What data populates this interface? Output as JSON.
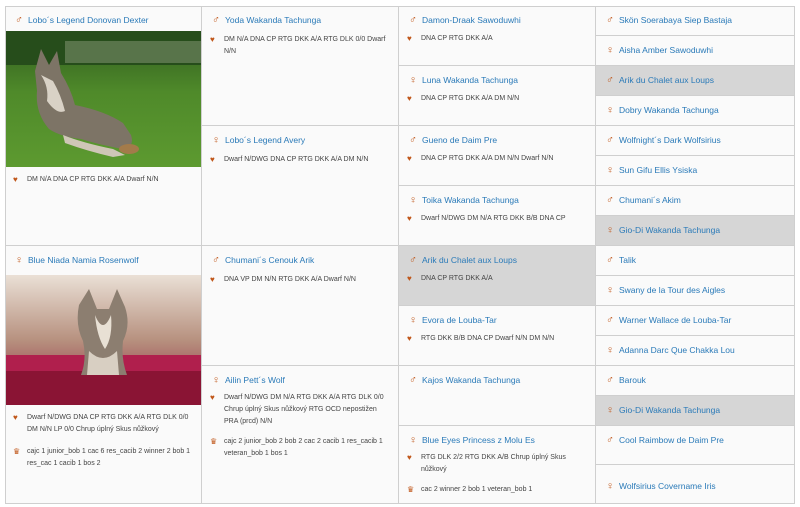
{
  "g1": [
    {
      "sex": "♂",
      "name": "Lobo´s Legend Donovan Dexter",
      "info": "DM N/A DNA CP RTG DKK A/A Dwarf N/N"
    },
    {
      "sex": "♀",
      "name": "Blue Niada Namia Rosenwolf",
      "info": "Dwarf N/DWG DNA CP RTG DKK A/A RTG DLK 0/0 DM N/N LP 0/0 Chrup úplný Skus nůžkový",
      "show": "cajc 1 junior_bob 1 cac 6 res_cacib 2 winner 2 bob 1 res_cac 1 cacib 1 bos 2"
    }
  ],
  "g2": [
    {
      "sex": "♂",
      "name": "Yoda Wakanda Tachunga",
      "info": "DM N/A DNA CP RTG DKK A/A RTG DLK 0/0 Dwarf N/N"
    },
    {
      "sex": "♀",
      "name": "Lobo´s Legend Avery",
      "info": "Dwarf N/DWG DNA CP RTG DKK A/A DM N/N"
    },
    {
      "sex": "♂",
      "name": "Chumani´s Cenouk Arik",
      "info": "DNA VP DM N/N RTG DKK A/A Dwarf N/N"
    },
    {
      "sex": "♀",
      "name": "Ailin Pett´s Wolf",
      "info": "Dwarf N/DWG DM N/A RTG DKK A/A RTG DLK 0/0 Chrup úplný Skus nůžkový RTG OCD nepostižen PRA (prcd) N/N",
      "show": "cajc 2 junior_bob 2 bob 2 cac 2 cacib 1 res_cacib 1 veteran_bob 1 bos 1"
    }
  ],
  "g3": [
    {
      "sex": "♂",
      "name": "Damon-Draak Sawoduwhi",
      "info": "DNA CP RTG DKK A/A"
    },
    {
      "sex": "♀",
      "name": "Luna Wakanda Tachunga",
      "info": "DNA CP RTG DKK A/A DM N/N"
    },
    {
      "sex": "♂",
      "name": "Gueno de Daim Pre",
      "info": "DNA CP RTG DKK A/A DM N/N Dwarf N/N"
    },
    {
      "sex": "♀",
      "name": "Toika Wakanda Tachunga",
      "info": "Dwarf N/DWG DM N/A RTG DKK B/B DNA CP"
    },
    {
      "sex": "♂",
      "name": "Arik du Chalet aux Loups",
      "info": "DNA CP RTG DKK A/A"
    },
    {
      "sex": "♀",
      "name": "Evora de Louba-Tar",
      "info": "RTG DKK B/B DNA CP Dwarf N/N DM N/N"
    },
    {
      "sex": "♂",
      "name": "Kajos Wakanda Tachunga",
      "info": ""
    },
    {
      "sex": "♀",
      "name": "Blue Eyes Princess z Molu Es",
      "info": "RTG DLK 2/2 RTG DKK A/B Chrup úplný Skus nůžkový",
      "show": "cac 2 winner 2 bob 1 veteran_bob 1"
    }
  ],
  "g4": [
    {
      "sex": "♂",
      "name": "Skön Soerabaya Siep Bastaja"
    },
    {
      "sex": "♀",
      "name": "Aisha Amber Sawoduwhi"
    },
    {
      "sex": "♂",
      "name": "Arik du Chalet aux Loups"
    },
    {
      "sex": "♀",
      "name": "Dobry Wakanda Tachunga"
    },
    {
      "sex": "♂",
      "name": "Wolfnight´s Dark Wolfsirius"
    },
    {
      "sex": "♀",
      "name": "Sun Gifu Ellis Ysiska"
    },
    {
      "sex": "♂",
      "name": "Chumani´s Akim"
    },
    {
      "sex": "♀",
      "name": "Gio-Di Wakanda Tachunga"
    },
    {
      "sex": "♂",
      "name": "Talik"
    },
    {
      "sex": "♀",
      "name": "Swany de la Tour des Aigles"
    },
    {
      "sex": "♂",
      "name": "Warner Wallace de Louba-Tar"
    },
    {
      "sex": "♀",
      "name": "Adanna Darc Que Chakka Lou"
    },
    {
      "sex": "♂",
      "name": "Barouk"
    },
    {
      "sex": "♀",
      "name": "Gio-Di Wakanda Tachunga"
    },
    {
      "sex": "♂",
      "name": "Cool Raimbow de Daim Pre"
    },
    {
      "sex": "♀",
      "name": "Wolfsirius Covername Iris"
    }
  ],
  "icons": {
    "dna": "dna-icon",
    "trophy": "trophy-icon",
    "male": "male-icon",
    "female": "female-icon"
  },
  "colors": {
    "link": "#2a7ab8",
    "accent": "#c0571a",
    "highlight": "#d6d6d6",
    "border": "#cfcfcf"
  }
}
